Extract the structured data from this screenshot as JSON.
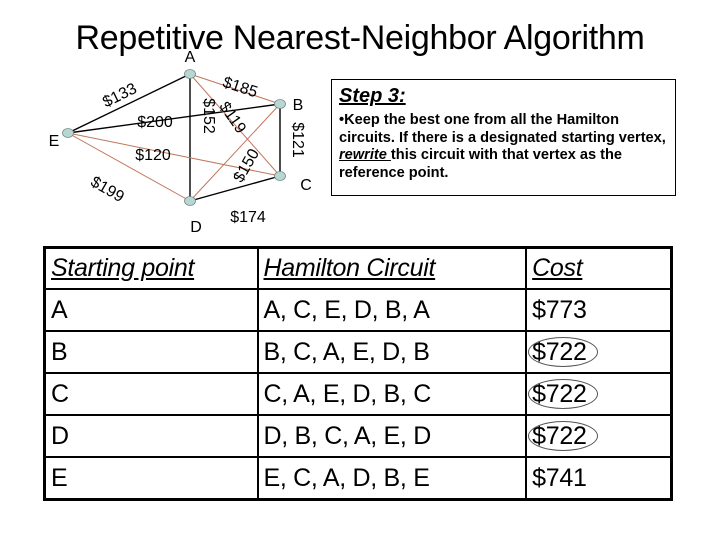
{
  "title": "Repetitive Nearest-Neighbor Algorithm",
  "graph": {
    "nodes": [
      {
        "id": "A",
        "label": "A"
      },
      {
        "id": "B",
        "label": "B"
      },
      {
        "id": "C",
        "label": "C"
      },
      {
        "id": "D",
        "label": "D"
      },
      {
        "id": "E",
        "label": "E"
      }
    ],
    "edges": [
      {
        "from": "E",
        "to": "A",
        "label": "$133",
        "style": "black"
      },
      {
        "from": "E",
        "to": "B",
        "label": "$200",
        "style": "black"
      },
      {
        "from": "A",
        "to": "D",
        "label": "$152",
        "style": "black"
      },
      {
        "from": "B",
        "to": "C",
        "label": "$121",
        "style": "black"
      },
      {
        "from": "D",
        "to": "C",
        "label": "$174",
        "style": "black"
      },
      {
        "from": "A",
        "to": "B",
        "label": "$185",
        "style": "red"
      },
      {
        "from": "A",
        "to": "C",
        "label": "$119",
        "style": "red"
      },
      {
        "from": "E",
        "to": "C",
        "label": "$120",
        "style": "red"
      },
      {
        "from": "E",
        "to": "D",
        "label": "$199",
        "style": "red"
      },
      {
        "from": "D",
        "to": "B",
        "label": "$150",
        "style": "red"
      }
    ],
    "colors": {
      "black_edge": "#000000",
      "red_edge": "#c0765a",
      "node_fill": "#b9d6d3",
      "node_stroke": "#6d8b88"
    }
  },
  "step": {
    "title": "Step 3:",
    "bullet": "•",
    "text_before": "Keep the best one from all the Hamilton circuits. If there is a designated starting vertex, ",
    "emphasis": "rewrite ",
    "text_after": "this circuit with that vertex as the reference point."
  },
  "table": {
    "headers": [
      "Starting point",
      "Hamilton Circuit",
      "Cost"
    ],
    "rows": [
      {
        "start": "A",
        "circuit": "A, C, E, D, B, A",
        "cost": "$773",
        "circled": false
      },
      {
        "start": "B",
        "circuit": "B, C, A, E, D, B",
        "cost": "$722",
        "circled": true
      },
      {
        "start": "C",
        "circuit": "C, A, E, D, B, C",
        "cost": "$722",
        "circled": true
      },
      {
        "start": "D",
        "circuit": "D, B, C, A, E, D",
        "cost": "$722",
        "circled": true
      },
      {
        "start": "E",
        "circuit": "E, C, A, D, B, E",
        "cost": "$741",
        "circled": false
      }
    ]
  }
}
